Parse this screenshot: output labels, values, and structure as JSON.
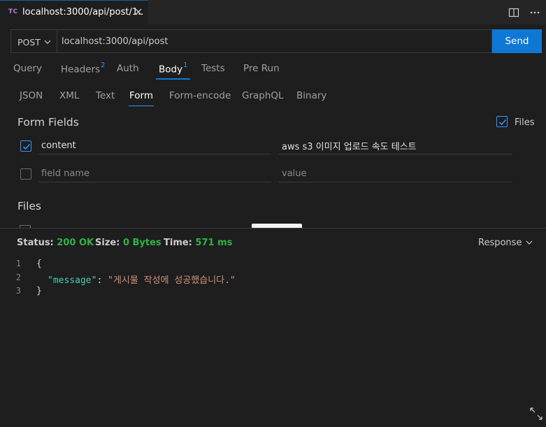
{
  "tab": {
    "badge": "TC",
    "title": "localhost:3000/api/post/1.."
  },
  "request": {
    "method": "POST",
    "url": "localhost:3000/api/post",
    "send_label": "Send"
  },
  "main_tabs": [
    {
      "label": "Query",
      "count": ""
    },
    {
      "label": "Headers",
      "count": "2"
    },
    {
      "label": "Auth",
      "count": ""
    },
    {
      "label": "Body",
      "count": "1"
    },
    {
      "label": "Tests",
      "count": ""
    },
    {
      "label": "Pre Run",
      "count": ""
    }
  ],
  "body_tabs": [
    "JSON",
    "XML",
    "Text",
    "Form",
    "Form-encode",
    "GraphQL",
    "Binary"
  ],
  "form": {
    "title": "Form Fields",
    "files_toggle_label": "Files",
    "rows": [
      {
        "name": "content",
        "value": "aws s3 이미지 업로드 속도 테스트"
      }
    ],
    "name_placeholder": "field name",
    "value_placeholder": "value",
    "files_title": "Files"
  },
  "status": {
    "status_label": "Status:",
    "status_value": "200 OK",
    "size_label": "Size:",
    "size_value": "0 Bytes",
    "time_label": "Time:",
    "time_value": "571 ms",
    "response_select": "Response"
  },
  "response_body": {
    "line_numbers": [
      "1",
      "2",
      "3"
    ],
    "open": "{",
    "key": "\"message\"",
    "sep": ": ",
    "value": "\"게시물 작성에 성공했습니다.\"",
    "close": "}"
  },
  "colors": {
    "accent": "#0e78d5",
    "success": "#2fb344",
    "json_key": "#4ec9b0",
    "json_string": "#ce9178"
  }
}
